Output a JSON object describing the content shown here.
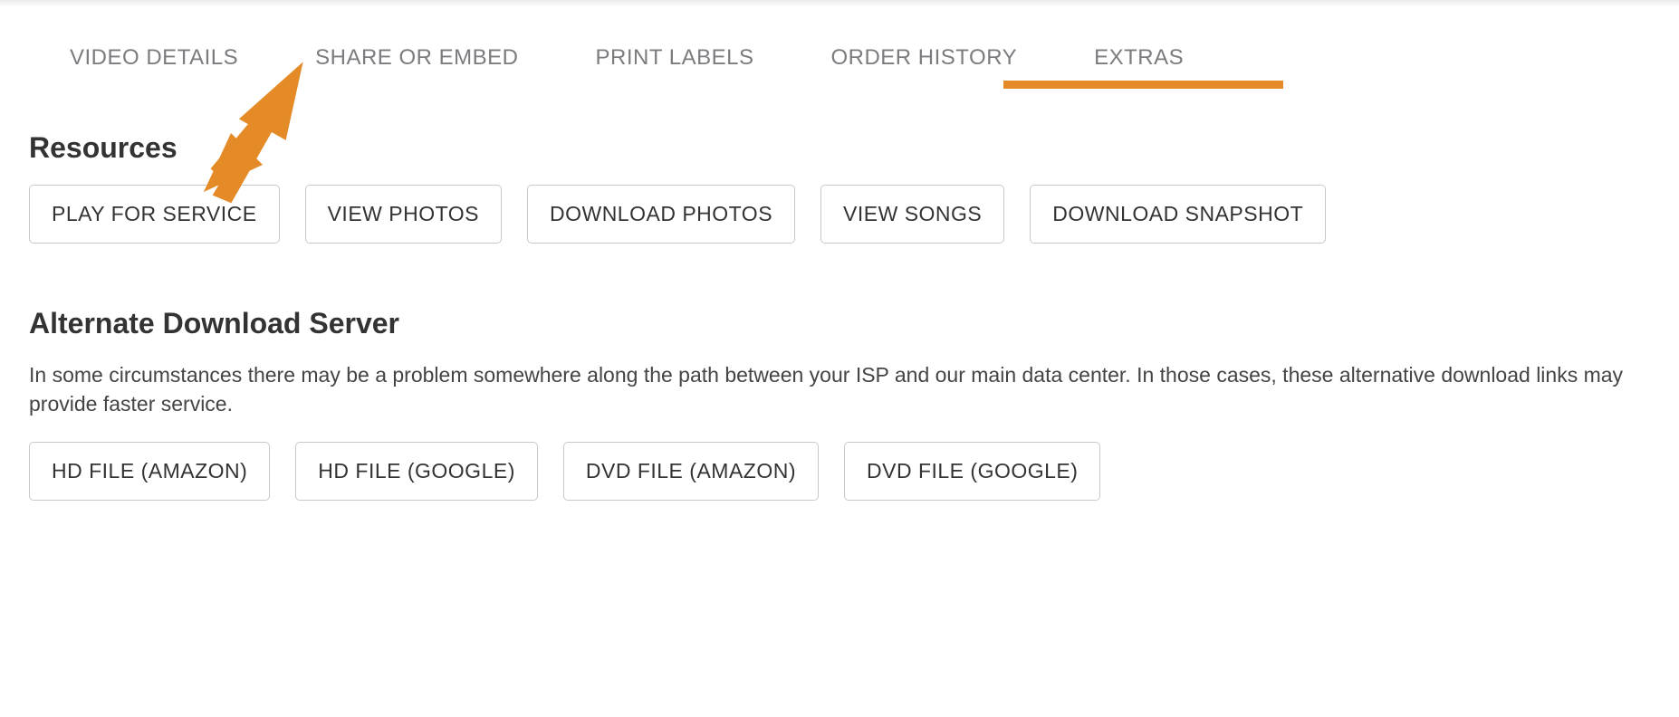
{
  "tabs": [
    {
      "label": "VIDEO DETAILS",
      "active": false
    },
    {
      "label": "SHARE OR EMBED",
      "active": false
    },
    {
      "label": "PRINT LABELS",
      "active": false
    },
    {
      "label": "ORDER HISTORY",
      "active": false
    },
    {
      "label": "EXTRAS",
      "active": true
    }
  ],
  "sections": {
    "resources": {
      "title": "Resources",
      "buttons": [
        "PLAY FOR SERVICE",
        "VIEW PHOTOS",
        "DOWNLOAD PHOTOS",
        "VIEW SONGS",
        "DOWNLOAD SNAPSHOT"
      ]
    },
    "alternate": {
      "title": "Alternate Download Server",
      "description": "In some circumstances there may be a problem somewhere along the path between your ISP and our main data center. In those cases, these alternative download links may provide faster service.",
      "buttons": [
        "HD FILE (AMAZON)",
        "HD FILE (GOOGLE)",
        "DVD FILE (AMAZON)",
        "DVD FILE (GOOGLE)"
      ]
    }
  },
  "colors": {
    "accent": "#e48a26",
    "text": "#333333",
    "tab_text": "#7a7c7f",
    "border": "#c9c9c9"
  }
}
